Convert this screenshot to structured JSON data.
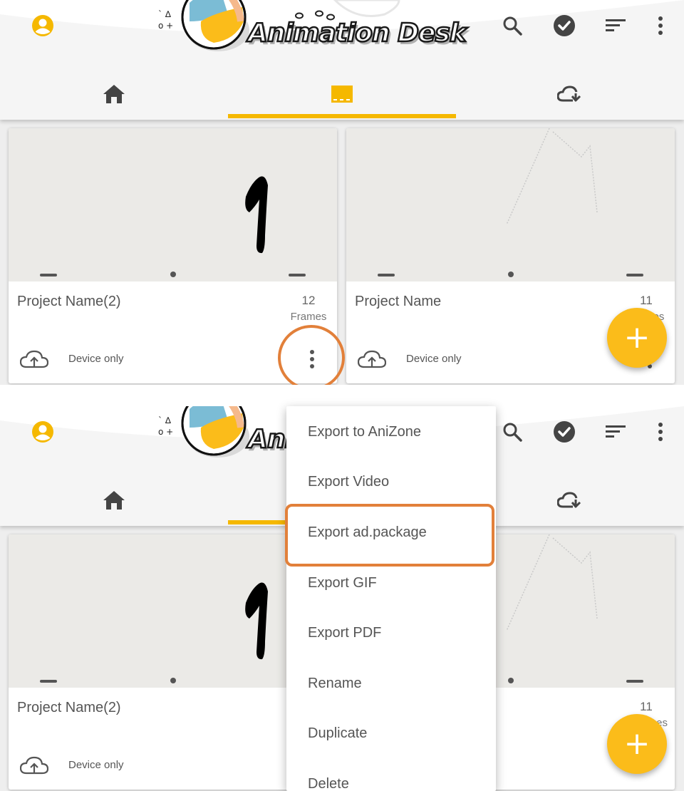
{
  "app": {
    "logo_text": "Animation Desk",
    "accent_color": "#f5b800",
    "highlight_color": "#e2803a"
  },
  "toolbar": {
    "icons": [
      "account-icon",
      "search-icon",
      "check-circle-icon",
      "sort-icon",
      "more-vert-icon"
    ]
  },
  "tabs": [
    {
      "name": "home",
      "icon": "home-icon",
      "selected": false
    },
    {
      "name": "projects",
      "icon": "film-strip-icon",
      "selected": true
    },
    {
      "name": "cloud",
      "icon": "cloud-download-icon",
      "selected": false
    }
  ],
  "projects": [
    {
      "name": "Project Name(2)",
      "frames": "12",
      "frames_label": "Frames",
      "status": "Device only",
      "status_icon": "cloud-upload-icon"
    },
    {
      "name": "Project Name",
      "frames": "11",
      "frames_label": "Frames",
      "status": "Device only",
      "status_icon": "cloud-upload-icon"
    }
  ],
  "bottom_panel": {
    "visible_frames_fragment": "es"
  },
  "context_menu": {
    "items": [
      "Export to AniZone",
      "Export Video",
      "Export ad.package",
      "Export GIF",
      "Export PDF",
      "Rename",
      "Duplicate",
      "Delete"
    ],
    "highlighted_item": "Export ad.package"
  },
  "fab": {
    "label": "+"
  }
}
